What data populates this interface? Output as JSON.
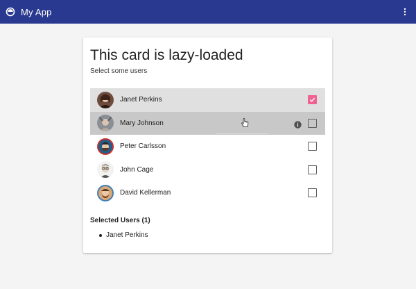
{
  "toolbar": {
    "app_icon": "app-logo-icon",
    "title": "My App",
    "menu_icon": "more-vert-icon",
    "color": "#2a3990"
  },
  "card": {
    "title": "This card is lazy-loaded",
    "subtitle": "Select some users"
  },
  "users": [
    {
      "name": "Janet Perkins",
      "checked": true
    },
    {
      "name": "Mary Johnson",
      "checked": false,
      "hovered": true,
      "info_icon": "info-icon"
    },
    {
      "name": "Peter Carlsson",
      "checked": false
    },
    {
      "name": "John Cage",
      "checked": false
    },
    {
      "name": "David Kellerman",
      "checked": false
    }
  ],
  "selected": {
    "heading": "Selected Users (1)",
    "items": [
      "Janet Perkins"
    ]
  },
  "colors": {
    "accent": "#f06292",
    "selected_row": "#e0e0e0",
    "hover_row": "#c8c8c8"
  }
}
